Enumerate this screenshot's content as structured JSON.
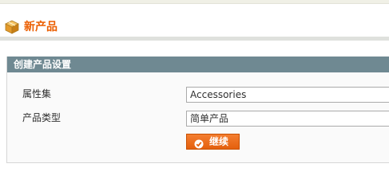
{
  "header": {
    "title": "新产品",
    "icon": "product-box-icon"
  },
  "form": {
    "legend": "创建产品设置",
    "attribute_set": {
      "label": "属性集",
      "value": "Accessories"
    },
    "product_type": {
      "label": "产品类型",
      "value": "简单产品"
    },
    "continue_button": {
      "label": "继续",
      "icon": "arrow-right-circle-icon"
    }
  },
  "colors": {
    "title": "#eb5e00",
    "legend_bg": "#6f8992",
    "button": "#f1721f"
  }
}
